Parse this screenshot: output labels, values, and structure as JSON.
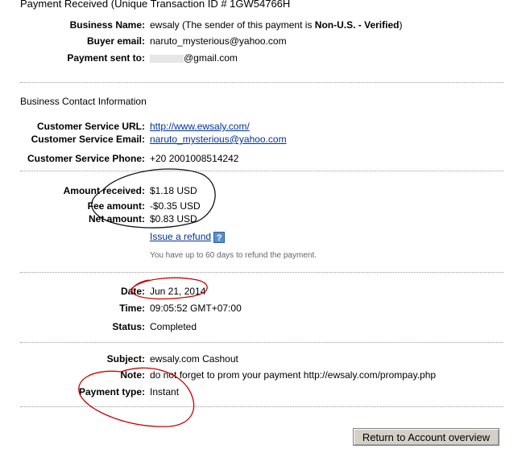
{
  "header": {
    "title": "Payment Received",
    "transaction": "(Unique Transaction ID # 1GW54766H"
  },
  "payment": {
    "business_name_label": "Business Name:",
    "business_name": "ewsaly",
    "sender_note_prefix": "(The sender of this payment is",
    "sender_status": "Non-U.S. - Verified",
    "sender_note_suffix": ")",
    "buyer_email_label": "Buyer email:",
    "buyer_email": "naruto_mysterious@yahoo.com",
    "sent_to_label": "Payment sent to:",
    "sent_to": "@gmail.com"
  },
  "contact": {
    "section_title": "Business Contact Information",
    "url_label": "Customer Service URL:",
    "url": "http://www.ewsaly.com/",
    "email_label": "Customer Service Email:",
    "email": "naruto_mysterious@yahoo.com",
    "phone_label": "Customer Service Phone:",
    "phone": "+20 2001008514242"
  },
  "amounts": {
    "received_label": "Amount received:",
    "received": "$1.18 USD",
    "fee_label": "Fee amount:",
    "fee": "-$0.35 USD",
    "net_label": "Net amount:",
    "net": "$0.83 USD",
    "refund_link": "Issue a refund",
    "refund_note": "You have up to 60 days to refund the payment."
  },
  "details": {
    "date_label": "Date:",
    "date": "Jun 21, 2014",
    "time_label": "Time:",
    "time": "09:05:52 GMT+07:00",
    "status_label": "Status:",
    "status": "Completed"
  },
  "extra": {
    "subject_label": "Subject:",
    "subject": "ewsaly.com Cashout",
    "note_label": "Note:",
    "note": "do not forget to prom your payment http://ewsaly.com/prompay.php",
    "payment_type_label": "Payment type:",
    "payment_type": "Instant"
  },
  "actions": {
    "return_button": "Return to Account overview"
  },
  "icons": {
    "help": "question-mark-icon"
  },
  "colors": {
    "link": "#003399",
    "annotation": "#cc0000"
  }
}
